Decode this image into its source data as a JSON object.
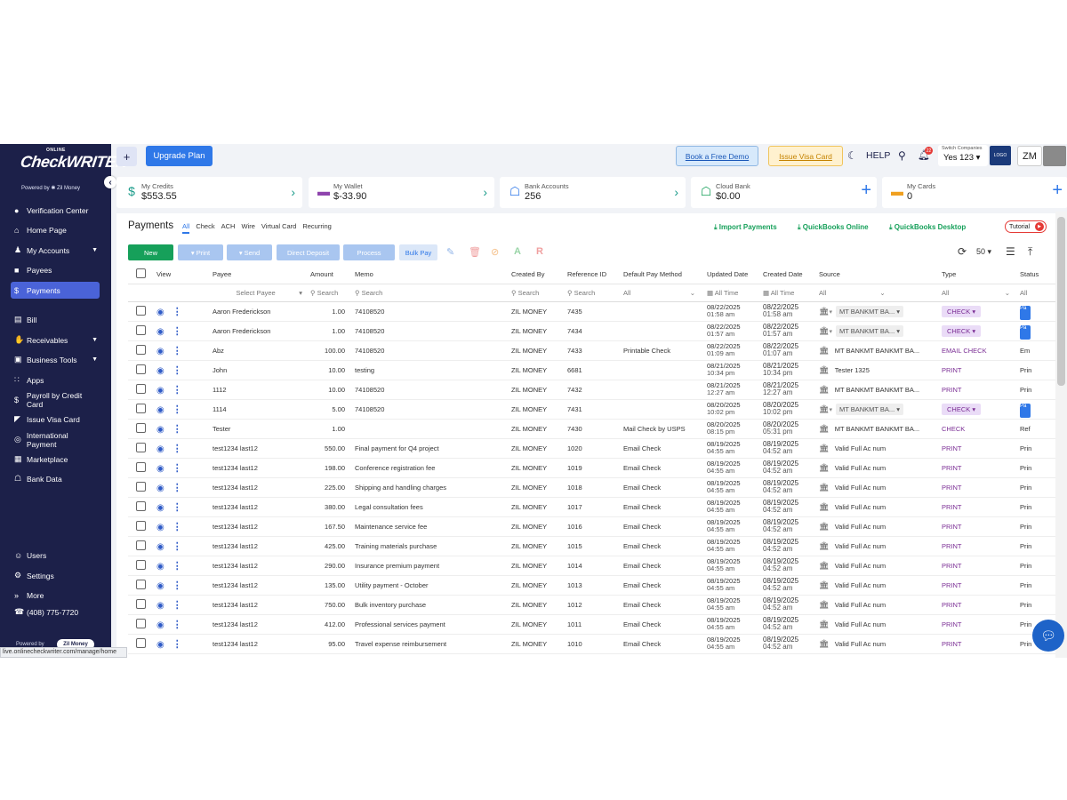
{
  "topbar": {
    "upgrade": "Upgrade Plan",
    "demo": "Book a Free Demo",
    "visa": "Issue Visa Card",
    "help": "HELP",
    "notif_count": "22",
    "company_label": "Switch Companies",
    "company_value": "Yes 123",
    "avatar": "ZM"
  },
  "logo": {
    "online": "ONLINE",
    "brand": "CheckWRITER",
    "powered": "Powered by ✱ Zil Money"
  },
  "sidebar": {
    "items": [
      {
        "label": "Verification Center",
        "icon": "●"
      },
      {
        "label": "Home Page",
        "icon": "⌂"
      },
      {
        "label": "My Accounts",
        "icon": "♟"
      },
      {
        "label": "Payees",
        "icon": "■"
      },
      {
        "label": "Payments",
        "icon": "$"
      },
      {
        "label": "Bill",
        "icon": "▤"
      },
      {
        "label": "Receivables",
        "icon": "✋"
      },
      {
        "label": "Business Tools",
        "icon": "▣"
      },
      {
        "label": "Apps",
        "icon": "∷"
      },
      {
        "label": "Payroll by Credit Card",
        "icon": "$"
      },
      {
        "label": "Issue Visa Card",
        "icon": "◤"
      },
      {
        "label": "International Payment",
        "icon": "◎"
      },
      {
        "label": "Marketplace",
        "icon": "▦"
      },
      {
        "label": "Bank Data",
        "icon": "☖"
      },
      {
        "label": "Users",
        "icon": "☺"
      },
      {
        "label": "Settings",
        "icon": "⚙"
      },
      {
        "label": "More",
        "icon": "»"
      },
      {
        "label": "(408) 775-7720",
        "icon": "☎"
      }
    ],
    "powered": "Powered by",
    "zil": "Zil Money",
    "url": "live.onlinecheckwriter.com/manage/home"
  },
  "cards": [
    {
      "label": "My Credits",
      "value": "$553.55",
      "icon": "$",
      "color": "#1a9b8a"
    },
    {
      "label": "My Wallet",
      "value": "$-33.90",
      "icon": "▬",
      "color": "#8e44ad"
    },
    {
      "label": "Bank Accounts",
      "value": "256",
      "icon": "☖",
      "color": "#2f78e8"
    },
    {
      "label": "Cloud Bank",
      "value": "$0.00",
      "icon": "☖",
      "color": "#16a05a"
    },
    {
      "label": "My Cards",
      "value": "0",
      "icon": "▬",
      "color": "#f0a020"
    }
  ],
  "main": {
    "title": "Payments",
    "tabs": [
      "All",
      "Check",
      "ACH",
      "Wire",
      "Virtual Card",
      "Recurring"
    ],
    "import": "⤓ Import Payments",
    "qbo": "⤓ QuickBooks Online",
    "qbd": "⤓ QuickBooks Desktop",
    "tutorial": "Tutorial",
    "buttons": {
      "new": "New",
      "print": "▾ Print",
      "send": "▾ Send",
      "direct": "Direct Deposit",
      "process": "Process",
      "bulk": "Bulk Pay"
    },
    "per_page": "50"
  },
  "table": {
    "headers": [
      "View",
      "Payee",
      "Amount",
      "Memo",
      "Created By",
      "Reference ID",
      "Default Pay Method",
      "Updated Date",
      "Created Date",
      "Source",
      "Type",
      "Status"
    ],
    "filters": {
      "payee": "Select Payee",
      "amount": "Search",
      "memo": "Search",
      "created_by": "Search",
      "ref": "Search",
      "method": "All",
      "updated": "All Time",
      "created": "All Time",
      "source": "All",
      "type": "All",
      "status": "All"
    },
    "rows": [
      {
        "payee": "Aaron Frederickson",
        "amount": "1.00",
        "memo": "74108520",
        "by": "ZIL MONEY",
        "ref": "7435",
        "method": "",
        "ud": "08/22/2025",
        "ut": "01:58 am",
        "cd": "08/22/2025",
        "ct": "01:58 am",
        "source": "MT BANKMT BA...",
        "src_pill": true,
        "type": "CHECK",
        "type_pill": true,
        "status": "Pa"
      },
      {
        "payee": "Aaron Frederickson",
        "amount": "1.00",
        "memo": "74108520",
        "by": "ZIL MONEY",
        "ref": "7434",
        "method": "",
        "ud": "08/22/2025",
        "ut": "01:57 am",
        "cd": "08/22/2025",
        "ct": "01:57 am",
        "source": "MT BANKMT BA...",
        "src_pill": true,
        "type": "CHECK",
        "type_pill": true,
        "status": "Pa"
      },
      {
        "payee": "Abz",
        "amount": "100.00",
        "memo": "74108520",
        "by": "ZIL MONEY",
        "ref": "7433",
        "method": "Printable Check",
        "ud": "08/22/2025",
        "ut": "01:09 am",
        "cd": "08/22/2025",
        "ct": "01:07 am",
        "source": "MT BANKMT BANKMT BA...",
        "src_pill": false,
        "type": "EMAIL CHECK",
        "type_pill": false,
        "status": "Em"
      },
      {
        "payee": "John",
        "amount": "10.00",
        "memo": "testing",
        "by": "ZIL MONEY",
        "ref": "6681",
        "method": "",
        "ud": "08/21/2025",
        "ut": "10:34 pm",
        "cd": "08/21/2025",
        "ct": "10:34 pm",
        "source": "Tester 1325",
        "src_pill": false,
        "type": "PRINT",
        "type_pill": false,
        "status": "Prin"
      },
      {
        "payee": "1112",
        "amount": "10.00",
        "memo": "74108520",
        "by": "ZIL MONEY",
        "ref": "7432",
        "method": "",
        "ud": "08/21/2025",
        "ut": "12:27 am",
        "cd": "08/21/2025",
        "ct": "12:27 am",
        "source": "MT BANKMT BANKMT BA...",
        "src_pill": false,
        "type": "PRINT",
        "type_pill": false,
        "status": "Prin"
      },
      {
        "payee": "1114",
        "amount": "5.00",
        "memo": "74108520",
        "by": "ZIL MONEY",
        "ref": "7431",
        "method": "",
        "ud": "08/20/2025",
        "ut": "10:02 pm",
        "cd": "08/20/2025",
        "ct": "10:02 pm",
        "source": "MT BANKMT BA...",
        "src_pill": true,
        "type": "CHECK",
        "type_pill": true,
        "status": "Pa"
      },
      {
        "payee": "Tester",
        "amount": "1.00",
        "memo": "",
        "by": "ZIL MONEY",
        "ref": "7430",
        "method": "Mail Check by USPS",
        "ud": "08/20/2025",
        "ut": "08:15 pm",
        "cd": "08/20/2025",
        "ct": "05:31 pm",
        "source": "MT BANKMT BANKMT BA...",
        "src_pill": false,
        "type": "CHECK",
        "type_pill": false,
        "status": "Ref"
      },
      {
        "payee": "test1234 last12",
        "amount": "550.00",
        "memo": "Final payment for Q4 project",
        "by": "ZIL MONEY",
        "ref": "1020",
        "method": "Email Check",
        "ud": "08/19/2025",
        "ut": "04:55 am",
        "cd": "08/19/2025",
        "ct": "04:52 am",
        "source": "Valid Full Ac num",
        "src_pill": false,
        "type": "PRINT",
        "type_pill": false,
        "status": "Prin"
      },
      {
        "payee": "test1234 last12",
        "amount": "198.00",
        "memo": "Conference registration fee",
        "by": "ZIL MONEY",
        "ref": "1019",
        "method": "Email Check",
        "ud": "08/19/2025",
        "ut": "04:55 am",
        "cd": "08/19/2025",
        "ct": "04:52 am",
        "source": "Valid Full Ac num",
        "src_pill": false,
        "type": "PRINT",
        "type_pill": false,
        "status": "Prin"
      },
      {
        "payee": "test1234 last12",
        "amount": "225.00",
        "memo": "Shipping and handling charges",
        "by": "ZIL MONEY",
        "ref": "1018",
        "method": "Email Check",
        "ud": "08/19/2025",
        "ut": "04:55 am",
        "cd": "08/19/2025",
        "ct": "04:52 am",
        "source": "Valid Full Ac num",
        "src_pill": false,
        "type": "PRINT",
        "type_pill": false,
        "status": "Prin"
      },
      {
        "payee": "test1234 last12",
        "amount": "380.00",
        "memo": "Legal consultation fees",
        "by": "ZIL MONEY",
        "ref": "1017",
        "method": "Email Check",
        "ud": "08/19/2025",
        "ut": "04:55 am",
        "cd": "08/19/2025",
        "ct": "04:52 am",
        "source": "Valid Full Ac num",
        "src_pill": false,
        "type": "PRINT",
        "type_pill": false,
        "status": "Prin"
      },
      {
        "payee": "test1234 last12",
        "amount": "167.50",
        "memo": "Maintenance service fee",
        "by": "ZIL MONEY",
        "ref": "1016",
        "method": "Email Check",
        "ud": "08/19/2025",
        "ut": "04:55 am",
        "cd": "08/19/2025",
        "ct": "04:52 am",
        "source": "Valid Full Ac num",
        "src_pill": false,
        "type": "PRINT",
        "type_pill": false,
        "status": "Prin"
      },
      {
        "payee": "test1234 last12",
        "amount": "425.00",
        "memo": "Training materials purchase",
        "by": "ZIL MONEY",
        "ref": "1015",
        "method": "Email Check",
        "ud": "08/19/2025",
        "ut": "04:55 am",
        "cd": "08/19/2025",
        "ct": "04:52 am",
        "source": "Valid Full Ac num",
        "src_pill": false,
        "type": "PRINT",
        "type_pill": false,
        "status": "Prin"
      },
      {
        "payee": "test1234 last12",
        "amount": "290.00",
        "memo": "Insurance premium payment",
        "by": "ZIL MONEY",
        "ref": "1014",
        "method": "Email Check",
        "ud": "08/19/2025",
        "ut": "04:55 am",
        "cd": "08/19/2025",
        "ct": "04:52 am",
        "source": "Valid Full Ac num",
        "src_pill": false,
        "type": "PRINT",
        "type_pill": false,
        "status": "Prin"
      },
      {
        "payee": "test1234 last12",
        "amount": "135.00",
        "memo": "Utility payment - October",
        "by": "ZIL MONEY",
        "ref": "1013",
        "method": "Email Check",
        "ud": "08/19/2025",
        "ut": "04:55 am",
        "cd": "08/19/2025",
        "ct": "04:52 am",
        "source": "Valid Full Ac num",
        "src_pill": false,
        "type": "PRINT",
        "type_pill": false,
        "status": "Prin"
      },
      {
        "payee": "test1234 last12",
        "amount": "750.00",
        "memo": "Bulk inventory purchase",
        "by": "ZIL MONEY",
        "ref": "1012",
        "method": "Email Check",
        "ud": "08/19/2025",
        "ut": "04:55 am",
        "cd": "08/19/2025",
        "ct": "04:52 am",
        "source": "Valid Full Ac num",
        "src_pill": false,
        "type": "PRINT",
        "type_pill": false,
        "status": "Prin"
      },
      {
        "payee": "test1234 last12",
        "amount": "412.00",
        "memo": "Professional services payment",
        "by": "ZIL MONEY",
        "ref": "1011",
        "method": "Email Check",
        "ud": "08/19/2025",
        "ut": "04:55 am",
        "cd": "08/19/2025",
        "ct": "04:52 am",
        "source": "Valid Full Ac num",
        "src_pill": false,
        "type": "PRINT",
        "type_pill": false,
        "status": "Prin"
      },
      {
        "payee": "test1234 last12",
        "amount": "95.00",
        "memo": "Travel expense reimbursement",
        "by": "ZIL MONEY",
        "ref": "1010",
        "method": "Email Check",
        "ud": "08/19/2025",
        "ut": "04:55 am",
        "cd": "08/19/2025",
        "ct": "04:52 am",
        "source": "Valid Full Ac num",
        "src_pill": false,
        "type": "PRINT",
        "type_pill": false,
        "status": "Prin"
      }
    ]
  }
}
